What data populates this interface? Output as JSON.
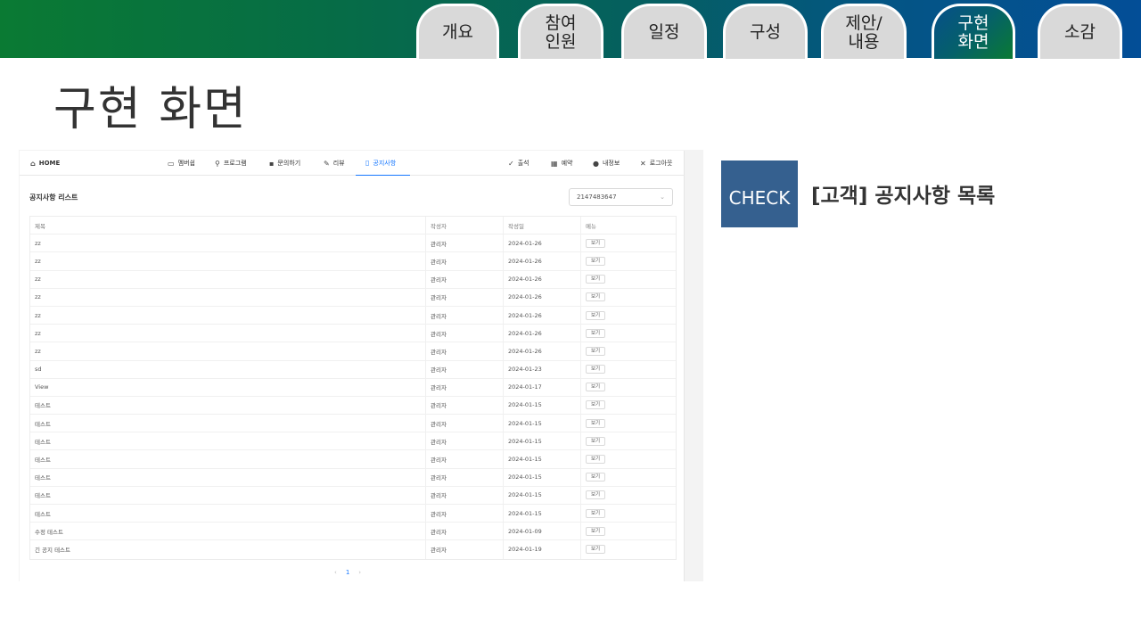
{
  "tabs": [
    {
      "label": "개요",
      "active": false
    },
    {
      "label": "참여\n인원",
      "active": false
    },
    {
      "label": "일정",
      "active": false
    },
    {
      "label": "구성",
      "active": false
    },
    {
      "label": "제안/\n내용",
      "active": false
    },
    {
      "label": "구현\n화면",
      "active": true
    },
    {
      "label": "소감",
      "active": false
    }
  ],
  "slide_title": "구현 화면",
  "screenshot": {
    "nav": {
      "home": "HOME",
      "items": [
        "멤버쉽",
        "프로그램",
        "문의하기",
        "리뷰",
        "공지사항"
      ],
      "right_items": [
        "출석",
        "예약",
        "내정보",
        "로그아웃"
      ]
    },
    "list_title": "공지사항 리스트",
    "select_value": "2147483647",
    "table": {
      "headers": [
        "제목",
        "작성자",
        "작성일",
        "메뉴"
      ],
      "rows": [
        [
          "zz",
          "관리자",
          "2024-01-26",
          "보기"
        ],
        [
          "zz",
          "관리자",
          "2024-01-26",
          "보기"
        ],
        [
          "zz",
          "관리자",
          "2024-01-26",
          "보기"
        ],
        [
          "zz",
          "관리자",
          "2024-01-26",
          "보기"
        ],
        [
          "zz",
          "관리자",
          "2024-01-26",
          "보기"
        ],
        [
          "zz",
          "관리자",
          "2024-01-26",
          "보기"
        ],
        [
          "zz",
          "관리자",
          "2024-01-26",
          "보기"
        ],
        [
          "sd",
          "관리자",
          "2024-01-23",
          "보기"
        ],
        [
          "View",
          "관리자",
          "2024-01-17",
          "보기"
        ],
        [
          "테스트",
          "관리자",
          "2024-01-15",
          "보기"
        ],
        [
          "테스트",
          "관리자",
          "2024-01-15",
          "보기"
        ],
        [
          "테스트",
          "관리자",
          "2024-01-15",
          "보기"
        ],
        [
          "테스트",
          "관리자",
          "2024-01-15",
          "보기"
        ],
        [
          "테스트",
          "관리자",
          "2024-01-15",
          "보기"
        ],
        [
          "테스트",
          "관리자",
          "2024-01-15",
          "보기"
        ],
        [
          "테스트",
          "관리자",
          "2024-01-15",
          "보기"
        ],
        [
          "수정 테스트",
          "관리자",
          "2024-01-09",
          "보기"
        ],
        [
          "긴 공지 테스트",
          "관리자",
          "2024-01-19",
          "보기"
        ]
      ]
    },
    "pager": {
      "prev": "‹",
      "current": "1",
      "next": "›"
    }
  },
  "check_label": "CHECK",
  "check_caption": "[고객] 공지사항 목록"
}
